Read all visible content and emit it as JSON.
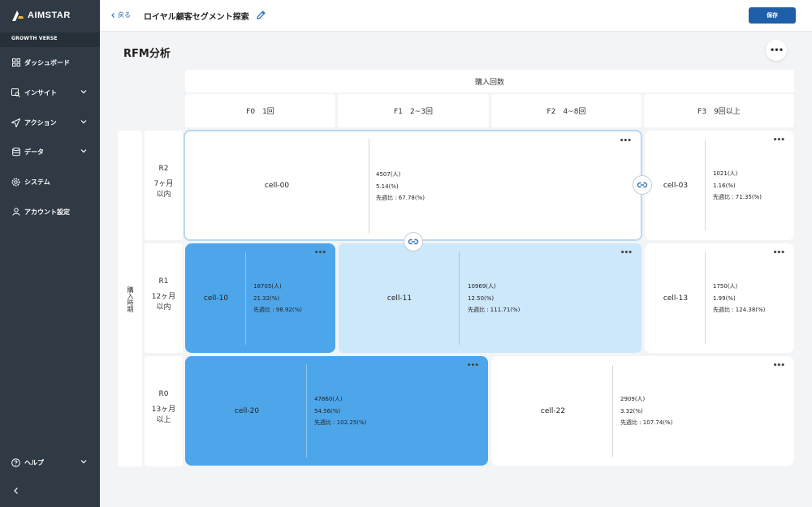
{
  "brand": {
    "logo_text": "AIMSTAR",
    "org": "GROWTH VERSE"
  },
  "nav": [
    {
      "label": "ダッシュボード",
      "icon": "dashboard-icon"
    },
    {
      "label": "インサイト",
      "icon": "insight-icon"
    },
    {
      "label": "アクション",
      "icon": "send-icon"
    },
    {
      "label": "データ",
      "icon": "database-icon"
    },
    {
      "label": "システム",
      "icon": "gear-icon"
    },
    {
      "label": "アカウント設定",
      "icon": "user-icon"
    }
  ],
  "help_label": "ヘルプ",
  "header": {
    "back_label": "戻る",
    "title": "ロイヤル顧客セグメント探索",
    "save_label": "保存"
  },
  "section_title": "RFM分析",
  "matrix": {
    "x_axis_label": "購入回数",
    "y_axis_label": "購入時期",
    "columns": [
      "F0　1回",
      "F1　2~3回",
      "F2　4~8回",
      "F3　9回以上"
    ],
    "rows": [
      {
        "code": "R2",
        "desc1": "7ヶ月",
        "desc2": "以内"
      },
      {
        "code": "R1",
        "desc1": "12ヶ月",
        "desc2": "以内"
      },
      {
        "code": "R0",
        "desc1": "13ヶ月",
        "desc2": "以上"
      }
    ],
    "cells": {
      "c00": {
        "name": "cell-00",
        "count": "4507(人)",
        "pct": "5.14(%)",
        "ratio": "先週比 : 67.78(%)"
      },
      "c03": {
        "name": "cell-03",
        "count": "1021(人)",
        "pct": "1.16(%)",
        "ratio": "先週比 : 71.35(%)"
      },
      "c10": {
        "name": "cell-10",
        "count": "18705(人)",
        "pct": "21.32(%)",
        "ratio": "先週比 : 98.92(%)"
      },
      "c11": {
        "name": "cell-11",
        "count": "10969(人)",
        "pct": "12.50(%)",
        "ratio": "先週比 : 111.71(%)"
      },
      "c13": {
        "name": "cell-13",
        "count": "1750(人)",
        "pct": "1.99(%)",
        "ratio": "先週比 : 124.38(%)"
      },
      "c20": {
        "name": "cell-20",
        "count": "47860(人)",
        "pct": "54.56(%)",
        "ratio": "先週比 : 102.25(%)"
      },
      "c22": {
        "name": "cell-22",
        "count": "2909(人)",
        "pct": "3.32(%)",
        "ratio": "先週比 : 107.74(%)"
      }
    }
  },
  "colors": {
    "sidebar": "#2f3a45",
    "primary": "#1f5fa8",
    "cell_mid": "#4ea6ea",
    "cell_light": "#cde7fb"
  }
}
